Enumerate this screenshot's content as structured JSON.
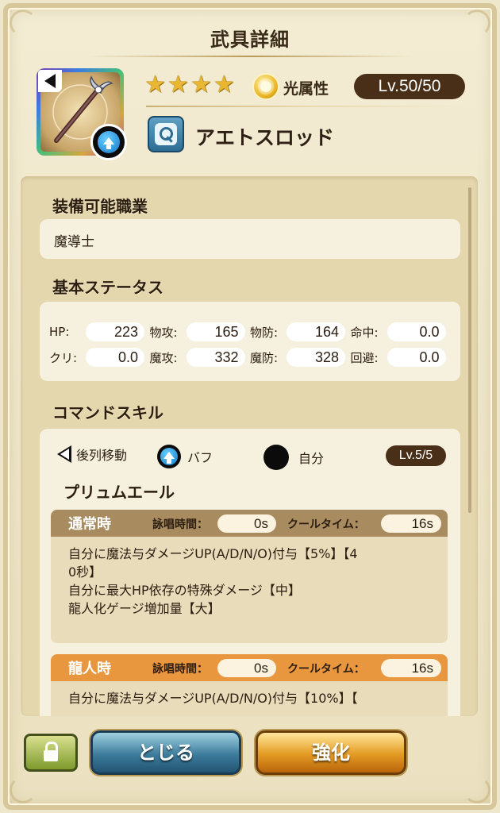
{
  "header": {
    "title": "武具詳細"
  },
  "weapon": {
    "name": "アエトスロッド",
    "stars": "★★★★",
    "element_label": "光属性",
    "level": "Lv.50/50",
    "element_icon": "light-element-icon",
    "type_icon": "rod-type-icon"
  },
  "sections": {
    "job_title": "装備可能職業",
    "job_value": "魔導士",
    "stats_title": "基本ステータス",
    "skill_title": "コマンドスキル"
  },
  "stats": [
    [
      {
        "label": "HP:",
        "value": "223"
      },
      {
        "label": "物攻:",
        "value": "165"
      },
      {
        "label": "物防:",
        "value": "164"
      },
      {
        "label": "命中:",
        "value": "0.0"
      }
    ],
    [
      {
        "label": "クリ:",
        "value": "0.0"
      },
      {
        "label": "魔攻:",
        "value": "332"
      },
      {
        "label": "魔防:",
        "value": "328"
      },
      {
        "label": "回避:",
        "value": "0.0"
      }
    ]
  ],
  "skill": {
    "tag_move": "後列移動",
    "tag_buff": "バフ",
    "tag_target": "自分",
    "level": "Lv.5/5",
    "name": "プリュムエール",
    "normal": {
      "label": "通常時",
      "cast_label": "詠唱時間：",
      "cast_value": "0s",
      "cool_label": "クールタイム：",
      "cool_value": "16s",
      "lines": [
        "自分に魔法与ダメージUP(A/D/N/O)付与【5%】【4",
        "0秒】",
        "自分に最大HP依存の特殊ダメージ【中】",
        "龍人化ゲージ増加量【大】"
      ]
    },
    "dragon": {
      "label": "龍人時",
      "cast_label": "詠唱時間：",
      "cast_value": "0s",
      "cool_label": "クールタイム：",
      "cool_value": "16s",
      "lines": [
        "自分に魔法与ダメージUP(A/D/N/O)付与【10%】【"
      ]
    }
  },
  "footer": {
    "close_label": "とじる",
    "enhance_label": "強化",
    "lock_icon": "lock-icon"
  },
  "colors": {
    "normal_header": "#a88b5f",
    "dragon_header": "#e9973f",
    "badge_bg": "#4a2f18"
  }
}
